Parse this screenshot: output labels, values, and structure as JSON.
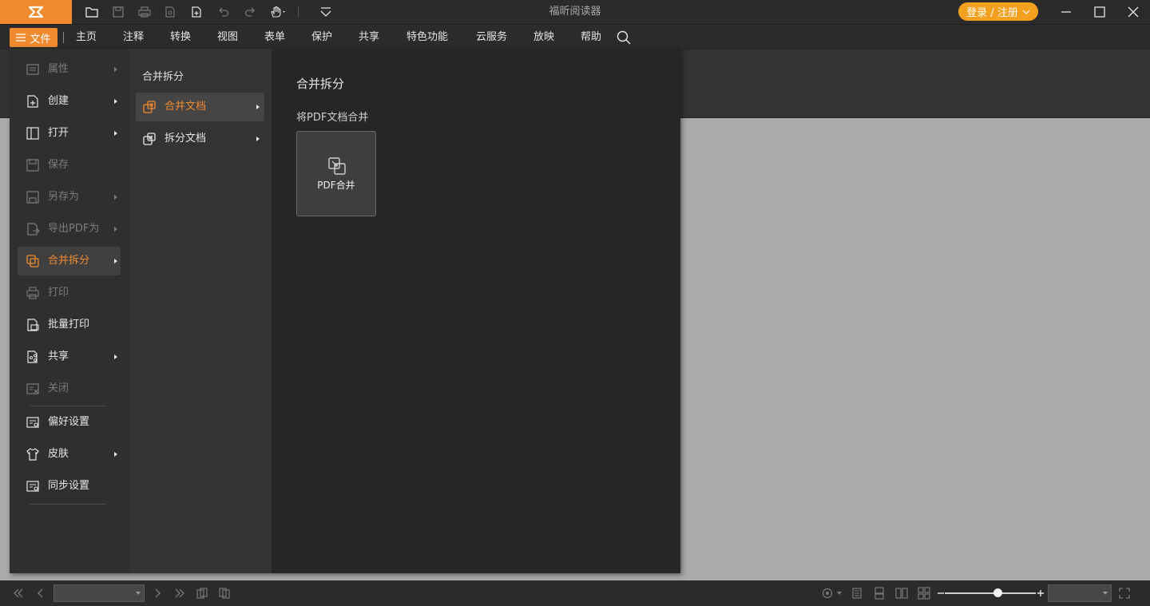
{
  "window": {
    "title": "福昕阅读器",
    "login_label": "登录 / 注册"
  },
  "quick_access": {
    "icons": [
      "open-folder-icon",
      "save-icon",
      "print-icon",
      "print-preview-icon",
      "new-file-icon",
      "undo-icon",
      "redo-icon",
      "hand-tool-icon",
      "customize-icon"
    ]
  },
  "menubar": {
    "file_label": "文件",
    "items": [
      "主页",
      "注释",
      "转换",
      "视图",
      "表单",
      "保护",
      "共享",
      "特色功能",
      "云服务",
      "放映",
      "帮助"
    ]
  },
  "file_menu": {
    "left": [
      {
        "label": "属性",
        "icon": "properties-icon",
        "enabled": false,
        "submenu": true
      },
      {
        "label": "创建",
        "icon": "create-icon",
        "enabled": true,
        "submenu": true
      },
      {
        "label": "打开",
        "icon": "open-icon",
        "enabled": true,
        "submenu": true
      },
      {
        "label": "保存",
        "icon": "save-icon",
        "enabled": false,
        "submenu": false
      },
      {
        "label": "另存为",
        "icon": "save-as-icon",
        "enabled": false,
        "submenu": true
      },
      {
        "label": "导出PDF为",
        "icon": "export-icon",
        "enabled": false,
        "submenu": true
      },
      {
        "label": "合并拆分",
        "icon": "merge-split-icon",
        "enabled": true,
        "submenu": true,
        "active": true
      },
      {
        "label": "打印",
        "icon": "print-icon",
        "enabled": false,
        "submenu": false
      },
      {
        "label": "批量打印",
        "icon": "batch-print-icon",
        "enabled": true,
        "submenu": false
      },
      {
        "label": "共享",
        "icon": "share-icon",
        "enabled": true,
        "submenu": true
      },
      {
        "label": "关闭",
        "icon": "close-doc-icon",
        "enabled": false,
        "submenu": false
      },
      {
        "label": "偏好设置",
        "icon": "preferences-icon",
        "enabled": true,
        "submenu": false
      },
      {
        "label": "皮肤",
        "icon": "skin-icon",
        "enabled": true,
        "submenu": true
      },
      {
        "label": "同步设置",
        "icon": "sync-settings-icon",
        "enabled": true,
        "submenu": false
      }
    ],
    "mid_title": "合并拆分",
    "mid_items": [
      {
        "label": "合并文档",
        "icon": "merge-document-icon",
        "active": true
      },
      {
        "label": "拆分文档",
        "icon": "split-document-icon",
        "active": false
      }
    ],
    "right_title": "合并拆分",
    "right_subtitle": "将PDF文档合并",
    "card_label": "PDF合并"
  },
  "statusbar": {
    "zoom_level": 0.58
  },
  "colors": {
    "accent": "#f08a2e",
    "login": "#f3a01f",
    "chrome": "#2b2b2b",
    "document_bg": "#aaaaaa"
  }
}
